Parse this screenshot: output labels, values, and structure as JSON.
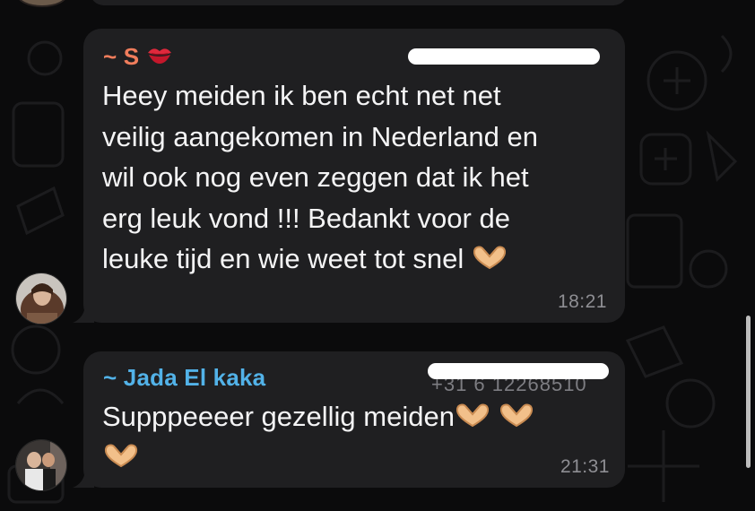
{
  "colors": {
    "background": "#0b0b0c",
    "bubble": "#1f1f21",
    "sender_1_color": "#f07d5c",
    "sender_2_color": "#52b2e8",
    "text": "#f4f4f5",
    "time": "#8e8e93"
  },
  "messages": [
    {
      "sender": "~ S",
      "sender_emoji": "kiss-mark-icon",
      "phone_partial": "",
      "text": "Heey meiden ik ben echt net net\nveilig aangekomen in Nederland en\nwil ook nog even zeggen dat ik het\nerg leuk vond !!! Bedankt voor de\nleuke tijd en wie weet tot snel",
      "time": "18:21"
    },
    {
      "sender": "~ Jada El kaka",
      "phone_partial": "+31 6 12268510",
      "text": "Supppeeeer gezellig meiden",
      "time": "21:31"
    }
  ]
}
